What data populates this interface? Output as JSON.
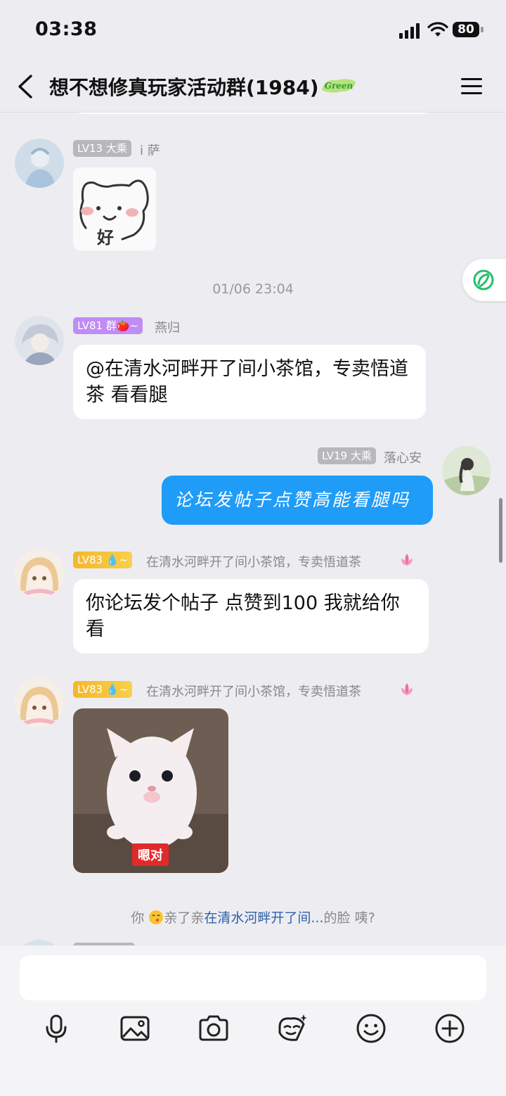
{
  "status": {
    "time": "03:38",
    "battery": "80"
  },
  "header": {
    "title": "想不想修真玩家活动群(1984)",
    "badge_text": "Green"
  },
  "messages": {
    "m1": {
      "level": "LV13 大乘",
      "nick": "i 萨",
      "sticker_text": "好"
    },
    "timestamp": "01/06 23:04",
    "m2": {
      "level": "LV81 群🍅~",
      "nick": "燕归",
      "text": "@在清水河畔开了间小茶馆，专卖悟道茶 看看腿"
    },
    "m3": {
      "level": "LV19 大乘",
      "nick": "落心安",
      "text": "论坛发帖子点赞高能看腿吗"
    },
    "m4": {
      "level": "LV83 💧~",
      "nick": "在清水河畔开了间小茶馆，专卖悟道茶",
      "text": "你论坛发个帖子 点赞到100 我就给你看"
    },
    "m5": {
      "level": "LV83 💧~",
      "nick": "在清水河畔开了间小茶馆，专卖悟道茶",
      "image_caption": "嗯对"
    },
    "system": {
      "prefix": "你",
      "middle": "亲了亲",
      "link": "在清水河畔开了间...",
      "suffix": "的脸 咦?"
    }
  },
  "input": {
    "placeholder": ""
  },
  "toolbar": [
    "mic-icon",
    "image-icon",
    "camera-icon",
    "sticker-icon",
    "emoji-icon",
    "add-icon"
  ]
}
